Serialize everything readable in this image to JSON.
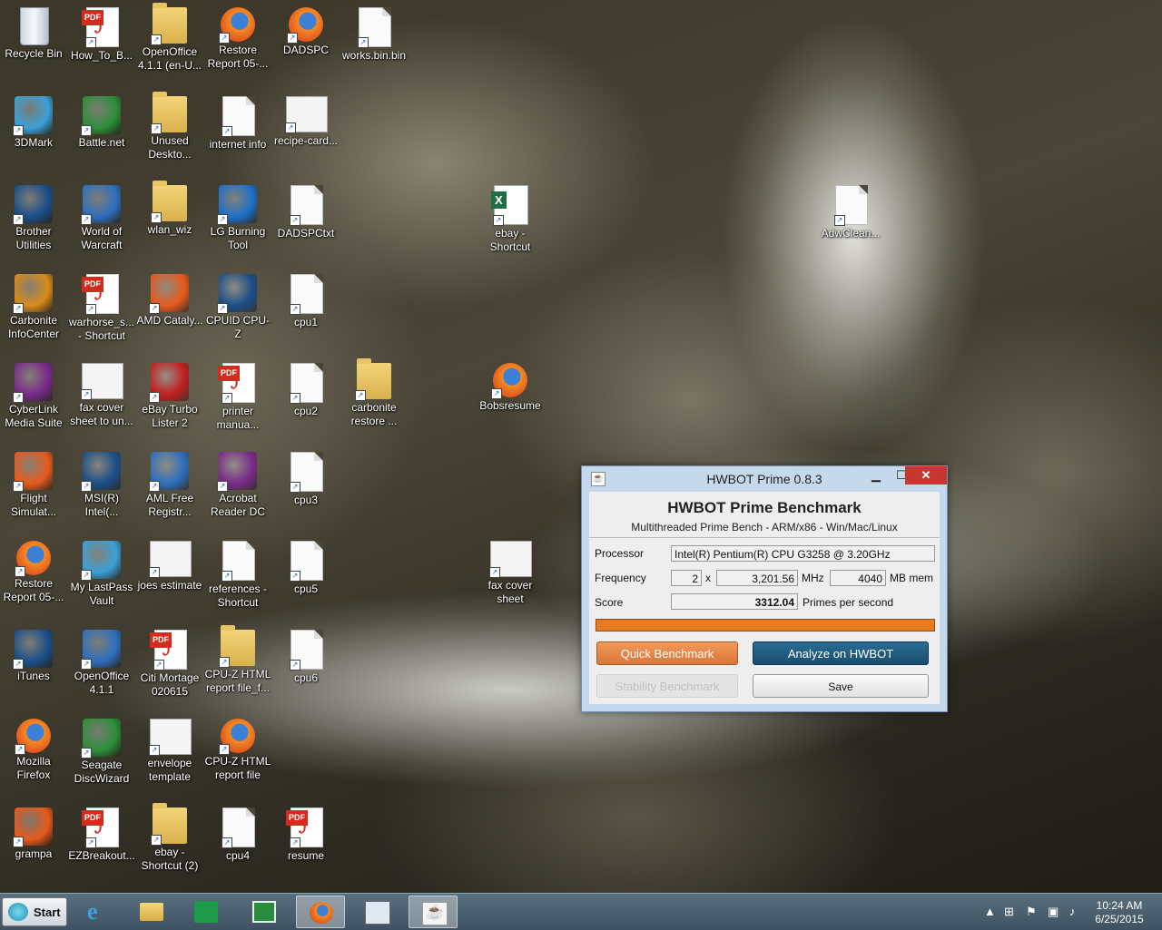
{
  "desktop_icons": [
    {
      "label": "Recycle Bin",
      "type": "bin"
    },
    {
      "label": "How_To_B...",
      "type": "pdf"
    },
    {
      "label": "OpenOffice 4.1.1 (en-U...",
      "type": "folder"
    },
    {
      "label": "Restore Report 05-...",
      "type": "ff"
    },
    {
      "label": "DADSPC",
      "type": "ff"
    },
    {
      "label": "works.bin.bin",
      "type": "doc"
    },
    {
      "label": "3DMark",
      "type": "app"
    },
    {
      "label": "Battle.net",
      "type": "app"
    },
    {
      "label": "Unused Deskto...",
      "type": "folder"
    },
    {
      "label": "internet info",
      "type": "doc"
    },
    {
      "label": "recipe-card...",
      "type": "shot"
    },
    {
      "label": "Brother Utilities",
      "type": "app"
    },
    {
      "label": "World of Warcraft",
      "type": "app"
    },
    {
      "label": "wlan_wiz",
      "type": "folder"
    },
    {
      "label": "LG Burning Tool",
      "type": "app"
    },
    {
      "label": "DADSPCtxt",
      "type": "doc"
    },
    {
      "label": "ebay - Shortcut",
      "type": "xls"
    },
    {
      "label": "AdwClean...",
      "type": "doc"
    },
    {
      "label": "Carbonite InfoCenter",
      "type": "app"
    },
    {
      "label": "warhorse_s... - Shortcut",
      "type": "pdf"
    },
    {
      "label": "AMD Cataly...",
      "type": "app"
    },
    {
      "label": "CPUID CPU-Z",
      "type": "app"
    },
    {
      "label": "cpu1",
      "type": "doc"
    },
    {
      "label": "CyberLink Media Suite",
      "type": "app"
    },
    {
      "label": "fax cover sheet to un...",
      "type": "shot"
    },
    {
      "label": "eBay Turbo Lister 2",
      "type": "app"
    },
    {
      "label": "printer manua...",
      "type": "pdf"
    },
    {
      "label": "cpu2",
      "type": "doc"
    },
    {
      "label": "carbonite restore ...",
      "type": "folder"
    },
    {
      "label": "Bobsresume",
      "type": "ff"
    },
    {
      "label": "Flight Simulat...",
      "type": "app"
    },
    {
      "label": "MSI(R) Intel(...",
      "type": "app"
    },
    {
      "label": "AML Free Registr...",
      "type": "app"
    },
    {
      "label": "Acrobat Reader DC",
      "type": "app"
    },
    {
      "label": "cpu3",
      "type": "doc"
    },
    {
      "label": "Restore Report 05-...",
      "type": "ff"
    },
    {
      "label": "My LastPass Vault",
      "type": "app"
    },
    {
      "label": "joes estimate",
      "type": "shot"
    },
    {
      "label": "references - Shortcut",
      "type": "doc"
    },
    {
      "label": "cpu5",
      "type": "doc"
    },
    {
      "label": "fax cover sheet",
      "type": "shot"
    },
    {
      "label": "iTunes",
      "type": "app"
    },
    {
      "label": "OpenOffice 4.1.1",
      "type": "app"
    },
    {
      "label": "Citi Mortage 020615",
      "type": "pdf"
    },
    {
      "label": "CPU-Z HTML report file_f...",
      "type": "folder"
    },
    {
      "label": "cpu6",
      "type": "doc"
    },
    {
      "label": "Mozilla Firefox",
      "type": "ff"
    },
    {
      "label": "Seagate DiscWizard",
      "type": "app"
    },
    {
      "label": "envelope template",
      "type": "shot"
    },
    {
      "label": "CPU-Z HTML report file",
      "type": "ff"
    },
    {
      "label": "grampa",
      "type": "app"
    },
    {
      "label": "EZBreakout...",
      "type": "pdf"
    },
    {
      "label": "ebay - Shortcut (2)",
      "type": "folder"
    },
    {
      "label": "cpu4",
      "type": "doc"
    },
    {
      "label": "resume",
      "type": "pdf"
    }
  ],
  "window": {
    "title": "HWBOT Prime 0.8.3",
    "heading": "HWBOT Prime Benchmark",
    "subheading": "Multithreaded Prime Bench - ARM/x86 - Win/Mac/Linux",
    "processor_label": "Processor",
    "processor_value": "Intel(R) Pentium(R) CPU G3258 @ 3.20GHz",
    "frequency_label": "Frequency",
    "cores": "2",
    "times": "x",
    "freq_value": "3,201.56",
    "freq_unit": "MHz",
    "mem_value": "4040",
    "mem_unit": "MB mem",
    "score_label": "Score",
    "score_value": "3312.04",
    "score_unit": "Primes per second",
    "progress_fraction": 1.0,
    "quick_btn": "Quick Benchmark",
    "analyze_btn": "Analyze on HWBOT",
    "stability_btn": "Stability Benchmark",
    "save_btn": "Save",
    "minimize_glyph": "▁",
    "maximize_glyph": "☐",
    "close_glyph": "✕"
  },
  "taskbar": {
    "start_label": "Start",
    "time": "10:24 AM",
    "date": "6/25/2015",
    "items": [
      "internet-explorer",
      "file-explorer",
      "windows-store",
      "calculator",
      "firefox",
      "calc-app",
      "java"
    ]
  },
  "colors": {
    "accent_orange": "#e87a22",
    "analyze_blue": "#1b4e6f",
    "close_red": "#c7372f"
  }
}
